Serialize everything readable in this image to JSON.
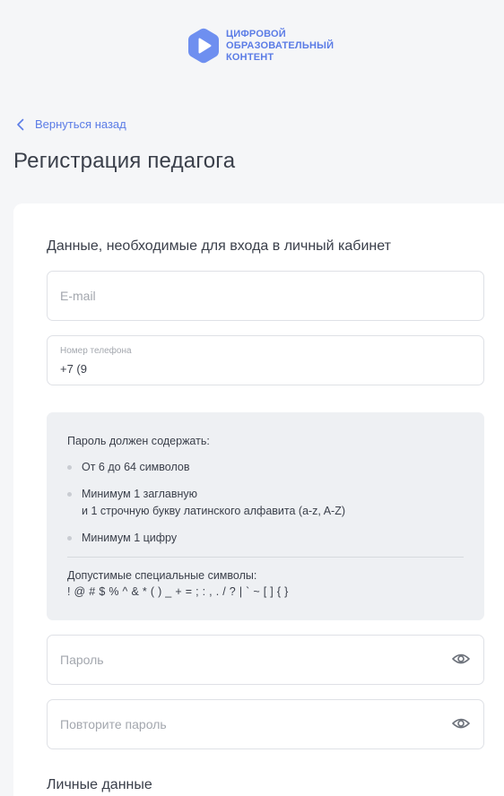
{
  "logo": {
    "line1": "ЦИФРОВОЙ",
    "line2": "ОБРАЗОВАТЕЛЬНЫЙ",
    "line3": "КОНТЕНТ",
    "icon": "play-hexagon-icon",
    "color": "#5b7ce6"
  },
  "back_label": "Вернуться назад",
  "page_title": "Регистрация педагога",
  "login_section": {
    "title": "Данные, необходимые для входа в личный кабинет",
    "email": {
      "placeholder": "E-mail",
      "value": ""
    },
    "phone": {
      "label": "Номер телефона",
      "value": "+7 (9"
    }
  },
  "password_rules": {
    "title": "Пароль должен содержать:",
    "items": [
      {
        "line1": "От 6 до 64 символов",
        "line2": ""
      },
      {
        "line1": "Минимум 1 заглавную",
        "line2": "и 1 строчную букву латинского алфавита (a-z, A-Z)"
      },
      {
        "line1": "Минимум 1 цифру",
        "line2": ""
      }
    ],
    "special_title": "Допустимые специальные символы:",
    "special_chars": "! @ # $ % ^ & * ( ) _ + = ; : , . / ? | ` ~ [ ] { }"
  },
  "password": {
    "placeholder": "Пароль",
    "icon": "eye-icon"
  },
  "password_repeat": {
    "placeholder": "Повторите пароль",
    "icon": "eye-icon"
  },
  "personal_section": {
    "title": "Личные данные"
  },
  "colors": {
    "accent": "#5b7ce6",
    "background": "#f5f6f8",
    "text": "#3a3f4a",
    "muted": "#a3a7ae",
    "rules_bg": "#eef0f3"
  }
}
